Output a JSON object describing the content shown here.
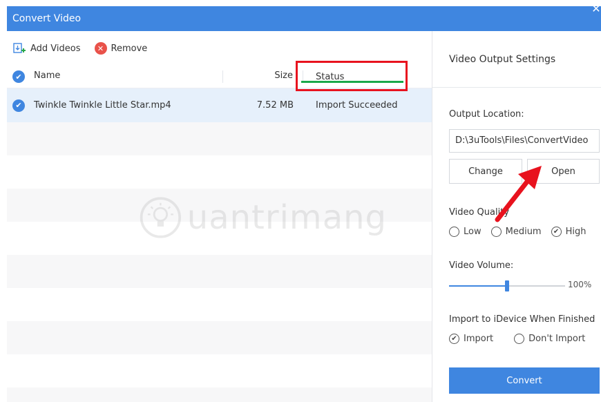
{
  "window": {
    "title": "Convert Video",
    "close_glyph": "✕"
  },
  "toolbar": {
    "add_label": "Add Videos",
    "remove_label": "Remove"
  },
  "table": {
    "headers": {
      "name": "Name",
      "size": "Size",
      "status": "Status"
    },
    "rows": [
      {
        "name": "Twinkle Twinkle Little Star.mp4",
        "size": "7.52 MB",
        "status": "Import Succeeded",
        "checked": true
      }
    ]
  },
  "watermark": {
    "text": "uantrimang"
  },
  "settings": {
    "title": "Video Output Settings",
    "output_location_label": "Output Location:",
    "output_path": "D:\\3uTools\\Files\\ConvertVideo",
    "change_label": "Change",
    "open_label": "Open",
    "quality_label": "Video Quality",
    "quality_options": [
      "Low",
      "Medium",
      "High"
    ],
    "quality_selected": "High",
    "volume_label": "Video Volume:",
    "volume_value": "100%",
    "volume_fraction": 0.5,
    "import_label": "Import to iDevice When Finished",
    "import_options": [
      "Import",
      "Don't Import"
    ],
    "import_selected": "Import",
    "convert_label": "Convert"
  },
  "colors": {
    "accent": "#3f86e0",
    "highlight_box": "#e8121e",
    "underline": "#1aa84a",
    "arrow": "#e8121e"
  },
  "icons": [
    "add-video-icon",
    "remove-icon",
    "check-icon",
    "close-icon",
    "radio-checked-icon",
    "radio-empty-icon",
    "lightbulb-logo-icon"
  ]
}
